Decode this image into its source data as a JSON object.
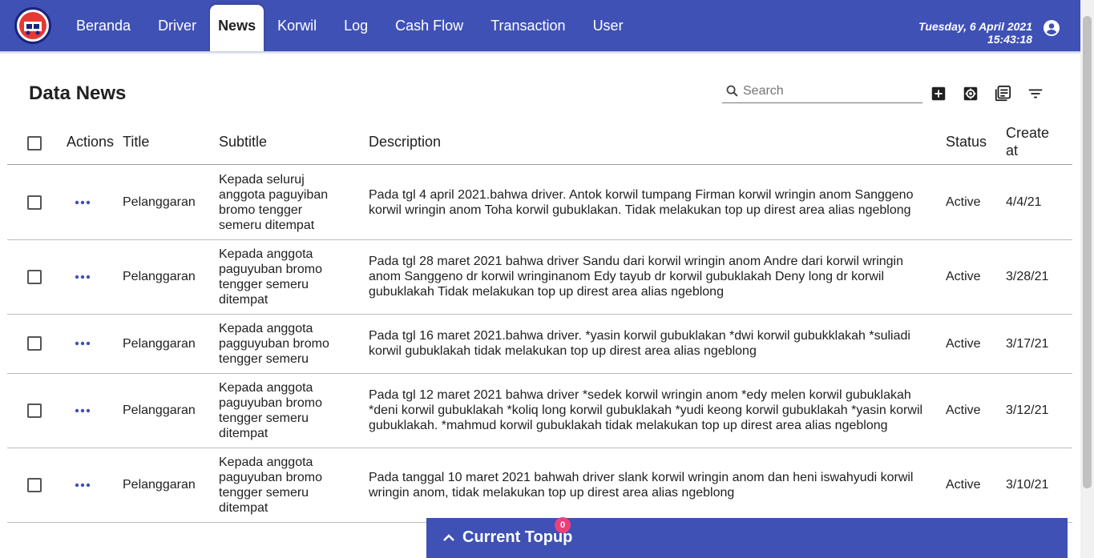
{
  "nav": {
    "items": [
      {
        "label": "Beranda",
        "active": false
      },
      {
        "label": "Driver",
        "active": false
      },
      {
        "label": "News",
        "active": true
      },
      {
        "label": "Korwil",
        "active": false
      },
      {
        "label": "Log",
        "active": false
      },
      {
        "label": "Cash Flow",
        "active": false
      },
      {
        "label": "Transaction",
        "active": false
      },
      {
        "label": "User",
        "active": false
      }
    ],
    "date": "Tuesday, 6 April 2021",
    "time": "15:43:18",
    "account_icon": "account-circle-icon"
  },
  "page": {
    "title": "Data News",
    "search_placeholder": "Search",
    "tools": [
      "add-box-icon",
      "settings-icon",
      "library-books-icon",
      "filter-list-icon"
    ]
  },
  "table": {
    "headers": {
      "actions": "Actions",
      "title": "Title",
      "subtitle": "Subtitle",
      "description": "Description",
      "status": "Status",
      "create_at": "Create at"
    },
    "rows": [
      {
        "title": "Pelanggaran",
        "subtitle": "Kepada seluruj anggota paguyiban bromo tengger semeru ditempat",
        "description": "Pada tgl 4 april 2021.bahwa driver. Antok korwil tumpang Firman korwil wringin anom Sanggeno korwil wringin anom Toha korwil gubuklakan. Tidak melakukan top up direst area alias ngeblong",
        "status": "Active",
        "create_at": "4/4/21"
      },
      {
        "title": "Pelanggaran",
        "subtitle": "Kepada anggota paguyuban bromo tengger semeru ditempat",
        "description": "Pada tgl 28 maret 2021 bahwa driver Sandu dari korwil wringin anom Andre dari korwil wringin anom Sanggeno dr korwil wringinanom Edy tayub dr korwil gubuklakah Deny long dr korwil gubuklakah Tidak melakukan top up direst area alias ngeblong",
        "status": "Active",
        "create_at": "3/28/21"
      },
      {
        "title": "Pelanggaran",
        "subtitle": "Kepada anggota pagguyuban bromo tengger semeru",
        "description": "Pada tgl 16 maret 2021.bahwa driver. *yasin korwil gubuklakan *dwi korwil gubukklakah *suliadi korwil gubuklakah tidak melakukan top up direst area alias ngeblong",
        "status": "Active",
        "create_at": "3/17/21"
      },
      {
        "title": "Pelanggaran",
        "subtitle": "Kepada anggota paguyuban bromo tengger semeru ditempat",
        "description": "Pada tgl 12 maret 2021 bahwa driver *sedek korwil wringin anom *edy melen korwil gubuklakah *deni korwil gubuklakah *koliq long korwil gubuklakah *yudi keong korwil gubuklakah *yasin korwil gubuklakah. *mahmud korwil gubuklakah tidak melakukan top up direst area alias ngeblong",
        "status": "Active",
        "create_at": "3/12/21"
      },
      {
        "title": "Pelanggaran",
        "subtitle": "Kepada anggota paguyuban bromo tengger semeru ditempat",
        "description": "Pada tanggal 10 maret 2021 bahwah driver slank korwil wringin anom dan heni iswahyudi korwil wringin anom, tidak melakukan top up direst area alias ngeblong",
        "status": "Active",
        "create_at": "3/10/21"
      }
    ]
  },
  "topup": {
    "label": "Current Topup",
    "badge": "0"
  },
  "colors": {
    "primary": "#3f51b5",
    "badge": "#ec407a"
  }
}
